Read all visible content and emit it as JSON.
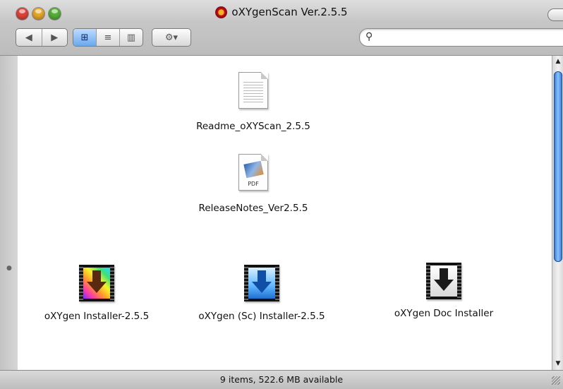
{
  "window": {
    "title": "oXYgenScan Ver.2.5.5"
  },
  "toolbar": {
    "back_glyph": "◀",
    "forward_glyph": "▶",
    "view_icon_glyph": "⊞",
    "view_list_glyph": "≡",
    "view_column_glyph": "▥",
    "action_glyph": "⚙▾",
    "search_glyph": "⚲",
    "search_value": ""
  },
  "items": {
    "readme": {
      "label": "Readme_oXYScan_2.5.5",
      "icon": "text-document-icon"
    },
    "releasenotes": {
      "label": "ReleaseNotes_Ver2.5.5",
      "icon": "pdf-document-icon",
      "badge": "PDF"
    },
    "installer": {
      "label": "oXYgen Installer-2.5.5",
      "icon": "installer-rainbow-icon"
    },
    "sc_installer": {
      "label": "oXYgen (Sc) Installer-2.5.5",
      "icon": "installer-blue-icon"
    },
    "doc_installer": {
      "label": "oXYgen Doc Installer",
      "icon": "installer-white-icon"
    }
  },
  "status": {
    "text": "9 items, 522.6 MB available"
  },
  "colors": {
    "close": "#e0443a",
    "minimize": "#e8a82a",
    "zoom": "#57b139",
    "scroll_thumb": "#2c6fc9"
  }
}
